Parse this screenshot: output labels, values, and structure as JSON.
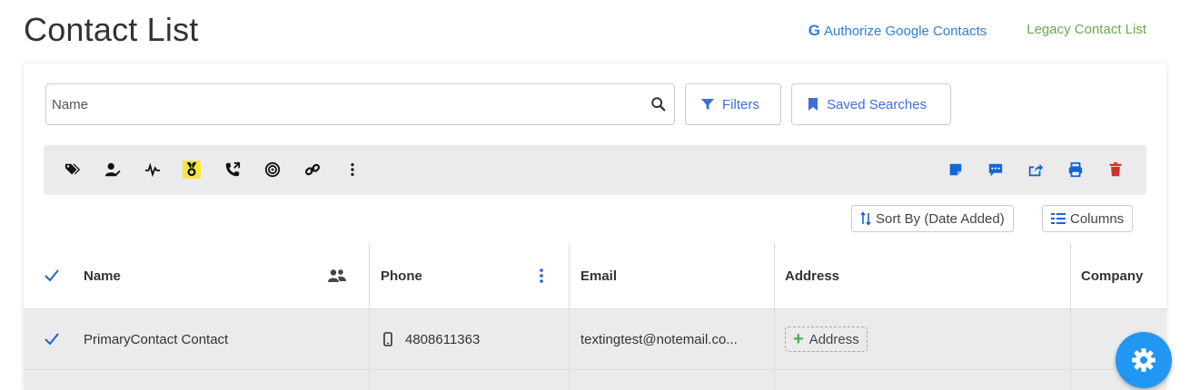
{
  "page": {
    "title": "Contact List"
  },
  "top_links": {
    "google": "Authorize Google Contacts",
    "google_glyph": "G",
    "legacy": "Legacy Contact List"
  },
  "search": {
    "placeholder": "Name",
    "value": ""
  },
  "buttons": {
    "filters": "Filters",
    "saved_searches": "Saved Searches",
    "sort_by": "Sort By (Date Added)",
    "columns": "Columns"
  },
  "toolbar": {
    "left_icons": [
      "tags-icon",
      "user-edit-icon",
      "activity-icon",
      "medal-icon",
      "phone-arrow-icon",
      "bullseye-icon",
      "link-icon",
      "more-vertical-icon"
    ],
    "right_icons": [
      "note-icon",
      "message-icon",
      "share-icon",
      "print-icon",
      "trash-icon"
    ],
    "highlight_color": "#f5e83a"
  },
  "table": {
    "headers": {
      "name": "Name",
      "phone": "Phone",
      "email": "Email",
      "address": "Address",
      "company": "Company"
    },
    "rows": [
      {
        "name": "PrimaryContact Contact",
        "phone": "4808611363",
        "email": "textingtest@notemail.co...",
        "address_button": "Address"
      }
    ]
  },
  "colors": {
    "accent": "#3d6fd8",
    "google": "#2f7fd8",
    "legacy": "#6aa84f",
    "fab": "#2196f3",
    "trash": "#d32f2f"
  }
}
